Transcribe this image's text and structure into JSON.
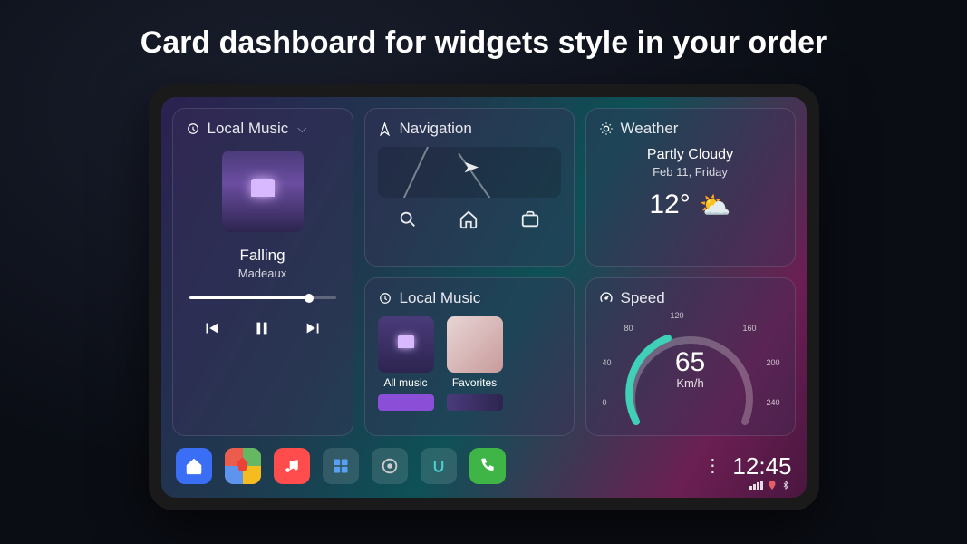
{
  "headline": "Card dashboard for widgets style in your order",
  "music": {
    "title": "Local Music",
    "track": "Falling",
    "artist": "Madeaux",
    "progress_pct": 82
  },
  "navigation": {
    "title": "Navigation"
  },
  "weather": {
    "title": "Weather",
    "condition": "Partly Cloudy",
    "date": "Feb 11, Friday",
    "temp": "12°"
  },
  "local_music2": {
    "title": "Local Music",
    "items": [
      "All music",
      "Favorites"
    ]
  },
  "speed": {
    "title": "Speed",
    "value": "65",
    "unit": "Km/h",
    "ticks": [
      "0",
      "40",
      "80",
      "120",
      "160",
      "200",
      "240"
    ]
  },
  "clock": "12:45"
}
